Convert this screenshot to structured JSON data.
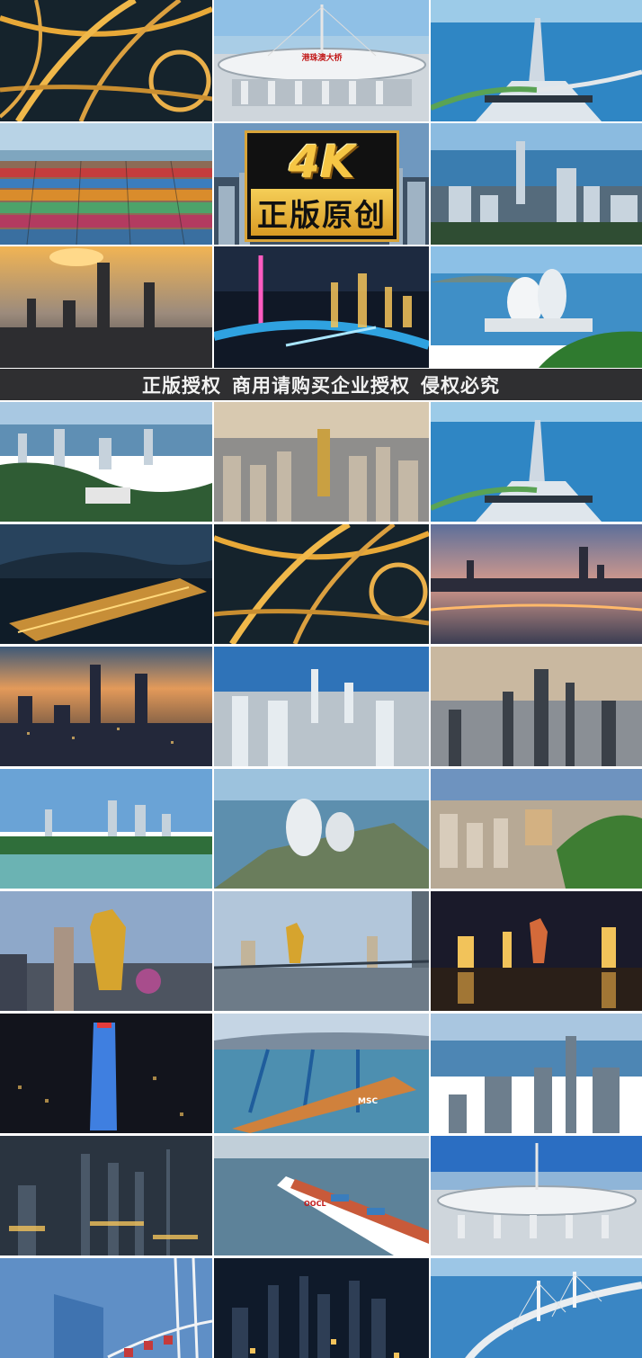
{
  "badge": {
    "resolution": "4K",
    "label": "正版原创"
  },
  "banner": {
    "part1": "正版授权",
    "part2": "商用请购买企业授权",
    "part3": "侵权必究"
  },
  "bridge_sign": "港珠澳大桥",
  "ship_text": "MSC",
  "ship2_text": "OOCL",
  "tiles_top": [
    {
      "scene": "highway-interchange-night"
    },
    {
      "scene": "bridge-toll-plaza"
    },
    {
      "scene": "bridge-island-aerial"
    },
    {
      "scene": "container-port"
    },
    {
      "scene": "city-skyline-badge"
    },
    {
      "scene": "harbor-skyline"
    },
    {
      "scene": "sunset-skyline"
    },
    {
      "scene": "tower-river-night"
    },
    {
      "scene": "opera-house-coast"
    }
  ],
  "tiles_bottom": [
    {
      "scene": "mountain-city-view"
    },
    {
      "scene": "dense-city-aerial"
    },
    {
      "scene": "bridge-island-aerial"
    },
    {
      "scene": "port-night"
    },
    {
      "scene": "highway-interchange-night"
    },
    {
      "scene": "waterfront-dusk"
    },
    {
      "scene": "city-dusk-towers"
    },
    {
      "scene": "city-blue-day"
    },
    {
      "scene": "misty-skyline"
    },
    {
      "scene": "bay-skyline-day"
    },
    {
      "scene": "opera-house-aerial"
    },
    {
      "scene": "old-town-cathedral"
    },
    {
      "scene": "lotus-tower-casino"
    },
    {
      "scene": "casino-waterfront"
    },
    {
      "scene": "casino-night-reflection"
    },
    {
      "scene": "lit-tower-night"
    },
    {
      "scene": "container-terminal-ship"
    },
    {
      "scene": "harbor-towers-day"
    },
    {
      "scene": "city-night-towers"
    },
    {
      "scene": "container-ship-sea"
    },
    {
      "scene": "bridge-toll-plaza"
    },
    {
      "scene": "glass-tower-ferris"
    },
    {
      "scene": "city-night-skyline"
    },
    {
      "scene": "bridge-over-sea"
    }
  ]
}
